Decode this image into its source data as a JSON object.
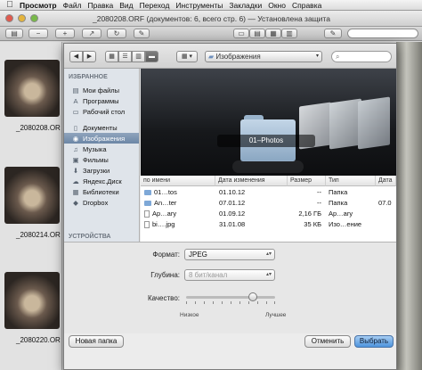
{
  "menubar": {
    "apple": "",
    "items": [
      "Просмотр",
      "Файл",
      "Правка",
      "Вид",
      "Переход",
      "Инструменты",
      "Закладки",
      "Окно",
      "Справка"
    ]
  },
  "window": {
    "title": "_2080208.ORF (документов: 6, всего стр. 6) — Установлена защита"
  },
  "thumbnails": [
    {
      "label": "_2080208.OR"
    },
    {
      "label": "_2080214.OR"
    },
    {
      "label": "_2080220.OR"
    }
  ],
  "dialog": {
    "location": "Изображения",
    "sidebar": {
      "section_favorites": "ИЗБРАННОЕ",
      "section_devices": "УСТРОЙСТВА",
      "items": [
        {
          "label": "Мои файлы",
          "icon": "all-files-icon"
        },
        {
          "label": "Программы",
          "icon": "applications-icon"
        },
        {
          "label": "Рабочий стол",
          "icon": "desktop-icon"
        },
        {
          "label": "Документы",
          "icon": "documents-icon"
        },
        {
          "label": "Изображения",
          "icon": "pictures-icon",
          "selected": true
        },
        {
          "label": "Музыка",
          "icon": "music-icon"
        },
        {
          "label": "Фильмы",
          "icon": "movies-icon"
        },
        {
          "label": "Загрузки",
          "icon": "downloads-icon"
        },
        {
          "label": "Яндекс.Диск",
          "icon": "yandex-disk-icon"
        },
        {
          "label": "Библиотеки",
          "icon": "libraries-icon"
        },
        {
          "label": "Dropbox",
          "icon": "dropbox-icon"
        }
      ]
    },
    "coverflow": {
      "caption": "01–Photos"
    },
    "table": {
      "headers": [
        "по имени",
        "Дата изменения",
        "Размер",
        "Тип",
        "Дата"
      ],
      "rows": [
        {
          "name": "01…tos",
          "date": "01.10.12",
          "size": "--",
          "type": "Папка",
          "date2": "",
          "kind": "folder"
        },
        {
          "name": "An…ter",
          "date": "07.01.12",
          "size": "--",
          "type": "Папка",
          "date2": "07.0",
          "kind": "folder"
        },
        {
          "name": "Ap…ary",
          "date": "01.09.12",
          "size": "2,16 ГБ",
          "type": "Ap…ary",
          "date2": "",
          "kind": "file"
        },
        {
          "name": "bi….jpg",
          "date": "31.01.08",
          "size": "35 КБ",
          "type": "Изо…ение",
          "date2": "",
          "kind": "file"
        }
      ]
    },
    "options": {
      "format_label": "Формат:",
      "format_value": "JPEG",
      "depth_label": "Глубина:",
      "depth_value": "8 бит/канал",
      "quality_label": "Качество:",
      "quality_low": "Низкое",
      "quality_high": "Лучшее",
      "quality_level": 0.75
    },
    "buttons": {
      "new_folder": "Новая папка",
      "cancel": "Отменить",
      "choose": "Выбрать"
    }
  }
}
